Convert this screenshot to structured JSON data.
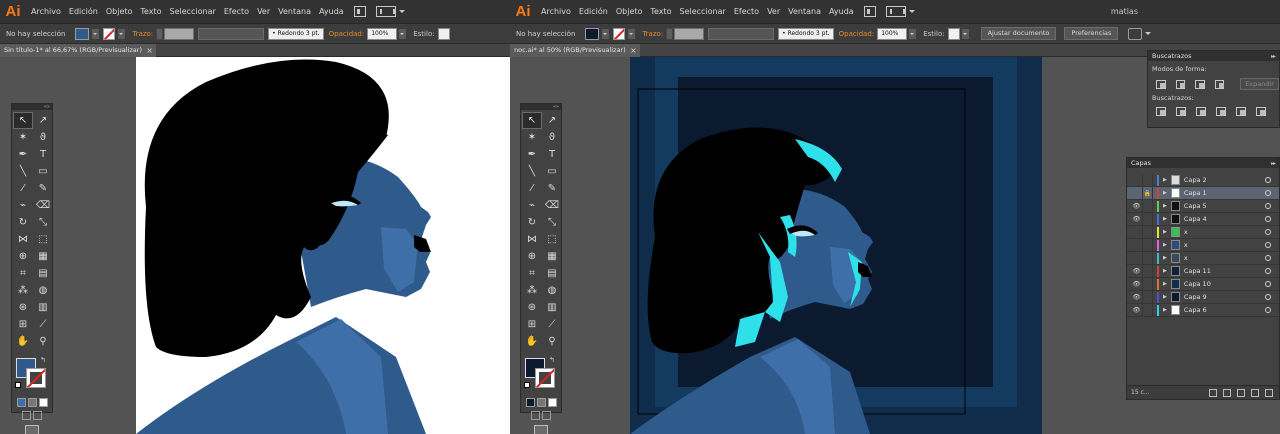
{
  "left": {
    "app_logo": "Ai",
    "menus": [
      "Archivo",
      "Edición",
      "Objeto",
      "Texto",
      "Seleccionar",
      "Efecto",
      "Ver",
      "Ventana",
      "Ayuda"
    ],
    "control": {
      "selection": "No hay selección",
      "fill_color": "#2e5a8c",
      "stroke_label": "Trazo:",
      "brush": "Redondo 3 pt.",
      "opacity_label": "Opacidad:",
      "opacity": "100%",
      "style_label": "Estilo:"
    },
    "tab": {
      "title": "Sin título-1* al 66,67% (RGB/Previsualizar)",
      "close": "×"
    },
    "fill_swatch": "#2e5a8c"
  },
  "right": {
    "app_logo": "Ai",
    "menus": [
      "Archivo",
      "Edición",
      "Objeto",
      "Texto",
      "Seleccionar",
      "Efecto",
      "Ver",
      "Ventana",
      "Ayuda"
    ],
    "user": "matias",
    "control": {
      "selection": "No hay selección",
      "fill_color": "#0b1a2e",
      "stroke_label": "Trazo:",
      "brush": "Redondo 3 pt.",
      "opacity_label": "Opacidad:",
      "opacity": "100%",
      "style_label": "Estilo:",
      "doc_setup_button": "Ajustar documento",
      "prefs_button": "Preferencias"
    },
    "tab": {
      "title": "noc.ai* al 50% (RGB/Previsualizar)",
      "close": "×"
    },
    "fill_swatch": "#0b1a2e",
    "pathfinder": {
      "title": "Buscatrazos",
      "shape_modes_label": "Modos de forma:",
      "expand_button": "Expandir",
      "pathfinders_label": "Buscatrazos:"
    },
    "layers": {
      "title": "Capas",
      "count": "15 c...",
      "rows": [
        {
          "name": "Capa 2",
          "visible": "",
          "locked": "",
          "color": "#4f7bd8",
          "thumb": "#dcdcdc"
        },
        {
          "name": "Capa 1",
          "visible": "",
          "locked": "🔒",
          "color": "#d04040",
          "thumb": "#ffffff"
        },
        {
          "name": "Capa 5",
          "visible": "👁",
          "locked": "",
          "color": "#5ad05a",
          "thumb": "#111111"
        },
        {
          "name": "Capa 4",
          "visible": "👁",
          "locked": "",
          "color": "#3f6fe0",
          "thumb": "#111111"
        },
        {
          "name": "x",
          "visible": "",
          "locked": "",
          "color": "#e0e040",
          "thumb": "#38c050"
        },
        {
          "name": "x",
          "visible": "",
          "locked": "",
          "color": "#e060e0",
          "thumb": "#2b4c7c"
        },
        {
          "name": "x",
          "visible": "",
          "locked": "",
          "color": "#30c0c0",
          "thumb": "#3a4a5a"
        },
        {
          "name": "Capa 11",
          "visible": "👁",
          "locked": "",
          "color": "#d04040",
          "thumb": "#0f2238"
        },
        {
          "name": "Capa 10",
          "visible": "👁",
          "locked": "",
          "color": "#e07030",
          "thumb": "#12304e"
        },
        {
          "name": "Capa 9",
          "visible": "👁",
          "locked": "",
          "color": "#5050d0",
          "thumb": "#0b1a2e"
        },
        {
          "name": "Capa 6",
          "visible": "👁",
          "locked": "",
          "color": "#30d0e0",
          "thumb": "#ffffff"
        }
      ]
    }
  },
  "colors": {
    "face_blue": "#2e5a8c",
    "skin_light": "#3f6fa8",
    "hair": "#000000",
    "eye": "#bfe7f5",
    "bg_dark": "#0b1a2e",
    "frame_mid": "#133a5f",
    "frame_outer": "#0f2d4a",
    "cyan": "#2de0ea"
  }
}
